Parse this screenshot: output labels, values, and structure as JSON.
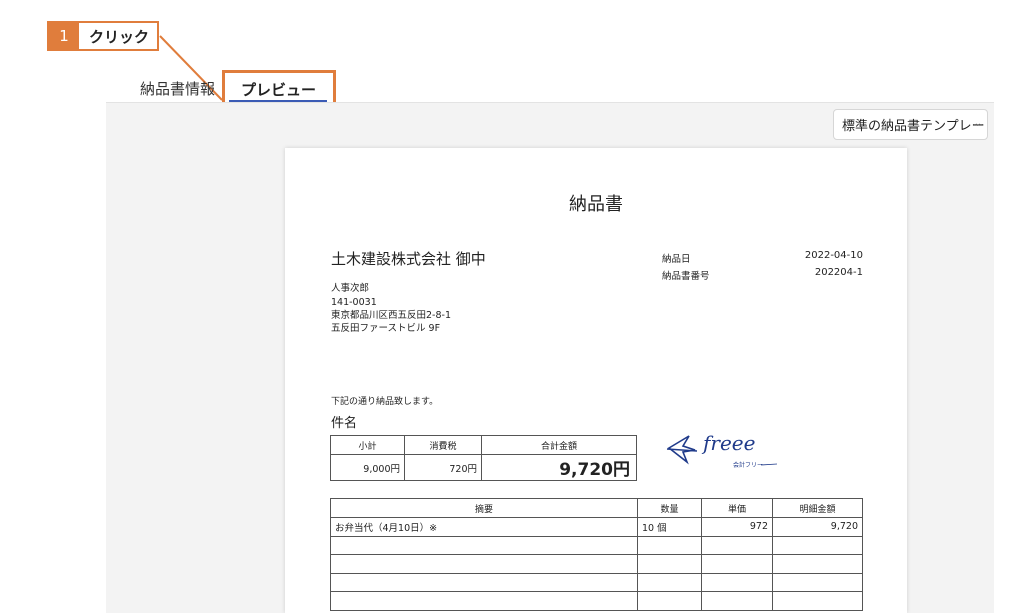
{
  "callout": {
    "number": "1",
    "text": "クリック"
  },
  "tabs": {
    "info": "納品書情報",
    "preview": "プレビュー"
  },
  "template_select": {
    "value": "標準の納品書テンプレー"
  },
  "document": {
    "title": "納品書",
    "client": "土木建設株式会社 御中",
    "address_lines": [
      "人事次郎",
      "141-0031",
      "東京都品川区西五反田2-8-1",
      "五反田ファーストビル 9F"
    ],
    "meta": [
      {
        "label": "納品日",
        "value": "2022-04-10"
      },
      {
        "label": "納品書番号",
        "value": "202204-1"
      }
    ],
    "intro": "下記の通り納品致します。",
    "subject_label": "件名",
    "summary": {
      "headers": [
        "小計",
        "消費税",
        "合計金額"
      ],
      "values": [
        "9,000円",
        "720円",
        "9,720円"
      ]
    },
    "items": {
      "headers": [
        "摘要",
        "数量",
        "単価",
        "明細金額"
      ],
      "rows": [
        [
          "お弁当代（4月10日）※",
          "10 個",
          "972",
          "9,720"
        ],
        [
          "",
          "",
          "",
          ""
        ],
        [
          "",
          "",
          "",
          ""
        ],
        [
          "",
          "",
          "",
          ""
        ],
        [
          "",
          "",
          "",
          ""
        ]
      ]
    },
    "logo": {
      "wordmark": "freee",
      "caption": "会計フリー"
    }
  },
  "colors": {
    "accent": "#e07d3c",
    "tab_underline": "#3b5bb5",
    "logo": "#1f3a8a"
  }
}
